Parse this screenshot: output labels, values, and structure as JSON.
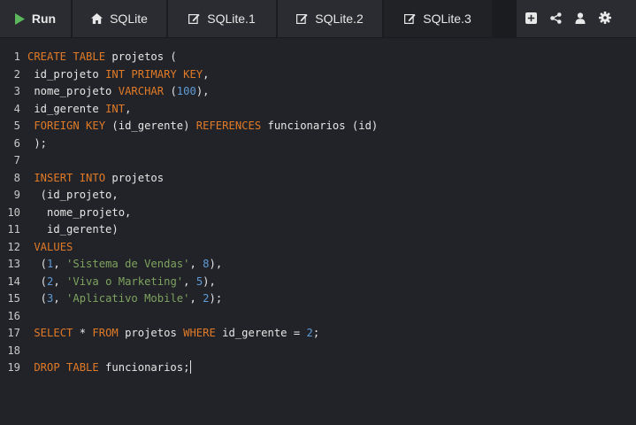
{
  "toolbar": {
    "run_label": "Run",
    "tabs": [
      {
        "label": "SQLite",
        "icon": "home-icon"
      },
      {
        "label": "SQLite.1",
        "icon": "edit-icon"
      },
      {
        "label": "SQLite.2",
        "icon": "edit-icon"
      },
      {
        "label": "SQLite.3",
        "icon": "edit-icon",
        "active": true
      }
    ],
    "actions": [
      "add-icon",
      "share-icon",
      "user-icon",
      "gear-icon"
    ]
  },
  "colors": {
    "keyword": "#e07a27",
    "number": "#5f9bd6",
    "string": "#7fa35f",
    "run_icon": "#5cb85c",
    "background": "#212328"
  },
  "editor": {
    "lines": [
      {
        "n": "1",
        "tokens": [
          [
            "kw",
            "CREATE TABLE"
          ],
          [
            "t",
            " projetos ("
          ]
        ]
      },
      {
        "n": "2",
        "tokens": [
          [
            "t",
            " id_projeto "
          ],
          [
            "kw",
            "INT PRIMARY KEY"
          ],
          [
            "t",
            ","
          ]
        ]
      },
      {
        "n": "3",
        "tokens": [
          [
            "t",
            " nome_projeto "
          ],
          [
            "kw",
            "VARCHAR"
          ],
          [
            "t",
            " ("
          ],
          [
            "num",
            "100"
          ],
          [
            "t",
            "),"
          ]
        ]
      },
      {
        "n": "4",
        "tokens": [
          [
            "t",
            " id_gerente "
          ],
          [
            "kw",
            "INT"
          ],
          [
            "t",
            ","
          ]
        ]
      },
      {
        "n": "5",
        "tokens": [
          [
            "t",
            " "
          ],
          [
            "kw",
            "FOREIGN KEY"
          ],
          [
            "t",
            " (id_gerente) "
          ],
          [
            "kw",
            "REFERENCES"
          ],
          [
            "t",
            " funcionarios (id)"
          ]
        ]
      },
      {
        "n": "6",
        "tokens": [
          [
            "t",
            " );"
          ]
        ]
      },
      {
        "n": "7",
        "tokens": []
      },
      {
        "n": "8",
        "tokens": [
          [
            "t",
            " "
          ],
          [
            "kw",
            "INSERT INTO"
          ],
          [
            "t",
            " projetos"
          ]
        ]
      },
      {
        "n": "9",
        "tokens": [
          [
            "t",
            "  (id_projeto,"
          ]
        ]
      },
      {
        "n": "10",
        "tokens": [
          [
            "t",
            "   nome_projeto,"
          ]
        ]
      },
      {
        "n": "11",
        "tokens": [
          [
            "t",
            "   id_gerente)"
          ]
        ]
      },
      {
        "n": "12",
        "tokens": [
          [
            "t",
            " "
          ],
          [
            "kw",
            "VALUES"
          ]
        ]
      },
      {
        "n": "13",
        "tokens": [
          [
            "t",
            "  ("
          ],
          [
            "num",
            "1"
          ],
          [
            "t",
            ", "
          ],
          [
            "str",
            "'Sistema de Vendas'"
          ],
          [
            "t",
            ", "
          ],
          [
            "num",
            "8"
          ],
          [
            "t",
            "),"
          ]
        ]
      },
      {
        "n": "14",
        "tokens": [
          [
            "t",
            "  ("
          ],
          [
            "num",
            "2"
          ],
          [
            "t",
            ", "
          ],
          [
            "str",
            "'Viva o Marketing'"
          ],
          [
            "t",
            ", "
          ],
          [
            "num",
            "5"
          ],
          [
            "t",
            "),"
          ]
        ]
      },
      {
        "n": "15",
        "tokens": [
          [
            "t",
            "  ("
          ],
          [
            "num",
            "3"
          ],
          [
            "t",
            ", "
          ],
          [
            "str",
            "'Aplicativo Mobile'"
          ],
          [
            "t",
            ", "
          ],
          [
            "num",
            "2"
          ],
          [
            "t",
            ");"
          ]
        ]
      },
      {
        "n": "16",
        "tokens": []
      },
      {
        "n": "17",
        "tokens": [
          [
            "t",
            " "
          ],
          [
            "kw",
            "SELECT"
          ],
          [
            "t",
            " * "
          ],
          [
            "kw",
            "FROM"
          ],
          [
            "t",
            " projetos "
          ],
          [
            "kw",
            "WHERE"
          ],
          [
            "t",
            " id_gerente = "
          ],
          [
            "num",
            "2"
          ],
          [
            "t",
            ";"
          ]
        ]
      },
      {
        "n": "18",
        "tokens": []
      },
      {
        "n": "19",
        "tokens": [
          [
            "t",
            " "
          ],
          [
            "kw",
            "DROP TABLE"
          ],
          [
            "t",
            " funcionarios;"
          ]
        ],
        "cursor": true
      }
    ]
  }
}
